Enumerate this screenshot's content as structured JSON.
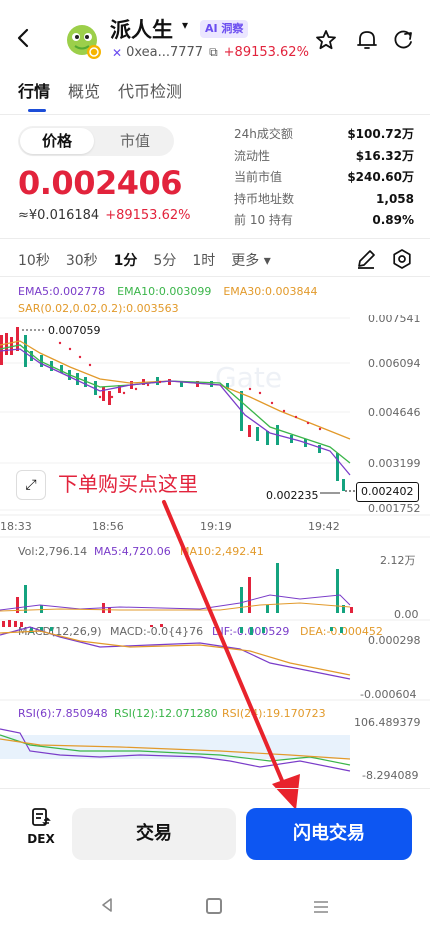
{
  "header": {
    "token_name": "派人生",
    "name_caret": "▾",
    "ai_badge": "AI 洞察",
    "address": "0xea...7777",
    "address_change": "+89153.62%"
  },
  "tabs": [
    "行情",
    "概览",
    "代币检测"
  ],
  "price_panel": {
    "toggle_price": "价格",
    "toggle_mcap": "市值",
    "price": "0.002406",
    "price_cny": "≈¥0.016184",
    "change": "+89153.62%",
    "stats": [
      {
        "label": "24h成交额",
        "value": "$100.72万"
      },
      {
        "label": "流动性",
        "value": "$16.32万"
      },
      {
        "label": "当前市值",
        "value": "$240.60万"
      },
      {
        "label": "持币地址数",
        "value": "1,058"
      },
      {
        "label": "前 10 持有",
        "value": "0.89%"
      }
    ]
  },
  "timeframes": [
    "10秒",
    "30秒",
    "1分",
    "5分",
    "1时",
    "更多 ▾"
  ],
  "indicators": {
    "ma5": "EMA5:0.002778",
    "ma10": "EMA10:0.003099",
    "ma30": "EMA30:0.003844",
    "sar": "SAR(0.02,0.02,0.2):0.003563",
    "vol": "Vol:2,796.14",
    "vol_ma5": "MA5:4,720.06",
    "vol_ma10": "MA10:2,492.41",
    "macd": "MACD(12,26,9)",
    "macd_val": "MACD:-0.0{4}76",
    "dif": "DIF:-0.000529",
    "dea": "DEA:-0.000452",
    "rsi6": "RSI(6):7.850948",
    "rsi12": "RSI(12):12.071280",
    "rsi24": "RSI(24):19.170723"
  },
  "chart": {
    "price_axis": [
      "0.007541",
      "0.006094",
      "0.004646",
      "0.003199",
      "0.001752"
    ],
    "time_axis": [
      "18:33",
      "18:56",
      "19:19",
      "19:42"
    ],
    "high_label": "0.007059",
    "low_label": "0.002235",
    "last_price": "0.002402",
    "vol_axis": [
      "2.12万",
      "0.00"
    ],
    "macd_axis": [
      "0.000298",
      "-0.000604"
    ],
    "rsi_axis": [
      "106.489379",
      "-8.294089"
    ],
    "watermark": "Gate"
  },
  "annotation": "下单购买点这里",
  "bottom_bar": {
    "dex": "DEX",
    "trade": "交易",
    "flash_trade": "闪电交易"
  },
  "colors": {
    "accent_blue": "#0d56f2",
    "up_red": "#e2233c",
    "down_green": "#14a37f"
  }
}
